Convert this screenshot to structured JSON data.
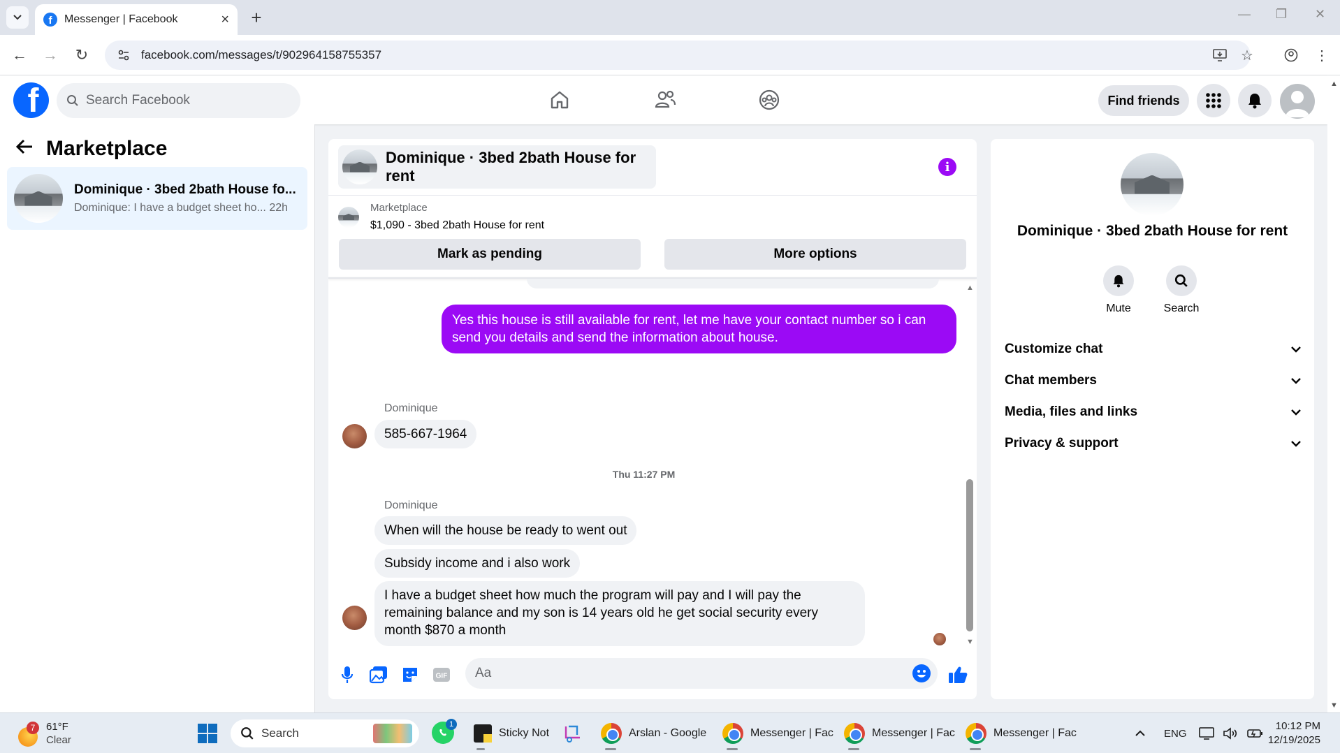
{
  "browser": {
    "tab_title": "Messenger | Facebook",
    "url": "facebook.com/messages/t/902964158755357"
  },
  "header": {
    "search_placeholder": "Search Facebook",
    "find_friends": "Find friends"
  },
  "left": {
    "title": "Marketplace",
    "conversation": {
      "name": "Dominique · 3bed 2bath House fo...",
      "preview": "Dominique: I have a budget sheet ho...",
      "time": "22h"
    }
  },
  "chat": {
    "title": "Dominique · 3bed 2bath House for rent",
    "marketplace_label": "Marketplace",
    "listing": "$1,090 - 3bed 2bath House for rent",
    "mark_pending": "Mark as pending",
    "more_options": "More options",
    "messages": {
      "out1": "Yes this house is still available for rent, let me have your contact number so i can send you details and send the information about house.",
      "sender1": "Dominique",
      "in1": "585-667-1964",
      "timestamp": "Thu 11:27 PM",
      "sender2": "Dominique",
      "in2": "When will the house be ready to went out",
      "in3": "Subsidy income and i also work",
      "in4": "I have a budget sheet how much the program will pay and I will pay the remaining balance and my son is 14 years old he get social security every month $870 a month"
    },
    "composer_placeholder": "Aa"
  },
  "right": {
    "name": "Dominique · 3bed 2bath House for rent",
    "mute": "Mute",
    "search": "Search",
    "sections": [
      "Customize chat",
      "Chat members",
      "Media, files and links",
      "Privacy & support"
    ]
  },
  "taskbar": {
    "weather_temp": "61°F",
    "weather_cond": "Clear",
    "weather_badge": "7",
    "search": "Search",
    "whatsapp_badge": "1",
    "sticky": "Sticky Not",
    "chrome1": "Arslan - Google",
    "chrome2": "Messenger | Fac",
    "chrome3": "Messenger | Fac",
    "chrome4": "Messenger | Fac",
    "lang": "ENG",
    "time": "10:12 PM",
    "date": "12/19/2025"
  },
  "colors": {
    "accent_purple": "#9b0af5",
    "facebook_blue": "#0866ff",
    "selected_bg": "#ebf5ff"
  }
}
